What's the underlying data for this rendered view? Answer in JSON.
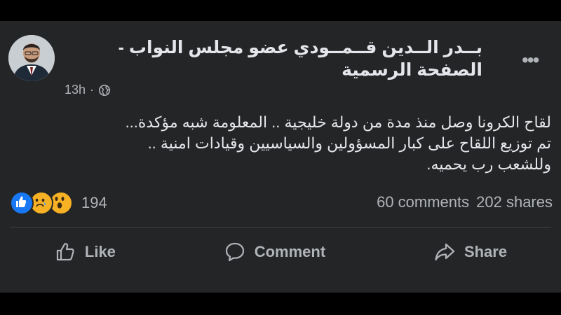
{
  "post": {
    "author": "بــدر الــدين قــمــودي عضو مجلس النواب - الصفحة الرسمية",
    "time": "13h",
    "privacy_icon": "globe-icon",
    "body_lines": [
      "لقاح الكرونا وصل منذ مدة من دولة خليجية .. المعلومة شبه مؤكدة...",
      "تم توزيع اللقاح على كبار المسؤولين والسياسيين وقيادات امنية ..",
      "وللشعب رب يحميه."
    ]
  },
  "engagement": {
    "reaction_icons": [
      "like-icon",
      "sad-icon",
      "wow-icon"
    ],
    "reaction_count": "194",
    "comments": "60 comments",
    "shares": "202 shares"
  },
  "actions": {
    "like_label": "Like",
    "comment_label": "Comment",
    "share_label": "Share"
  },
  "colors": {
    "card_bg": "#242526",
    "text_primary": "#e4e6eb",
    "text_secondary": "#b0b3b8",
    "like_blue": "#1877f2",
    "emoji_yellow": "#f7b125"
  }
}
